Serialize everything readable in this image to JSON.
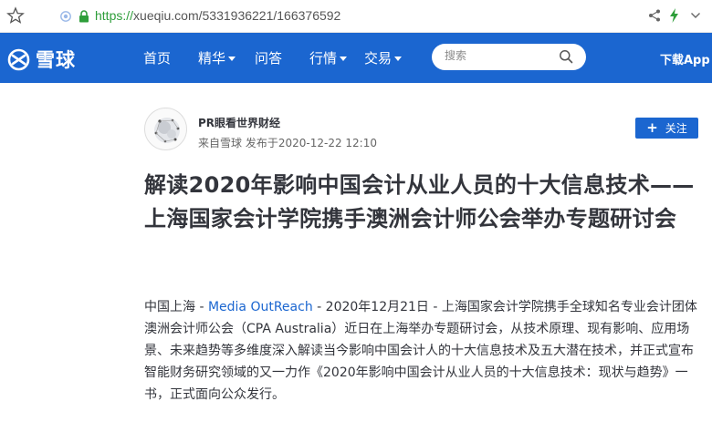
{
  "browser": {
    "url_scheme": "https://",
    "url_rest": "xueqiu.com/5331936221/166376592"
  },
  "site": {
    "logo_text": "雪球",
    "nav": [
      {
        "label": "首页",
        "has_dropdown": false
      },
      {
        "label": "精华",
        "has_dropdown": true
      },
      {
        "label": "问答",
        "has_dropdown": false
      },
      {
        "label": "行情",
        "has_dropdown": true
      },
      {
        "label": "交易",
        "has_dropdown": true
      }
    ],
    "search_placeholder": "搜索",
    "download_label": "下载App",
    "brand_color": "#1b66d0"
  },
  "author": {
    "name": "PR眼看世界财经",
    "source": "来自雪球",
    "published": "发布于2020-12-22 12:10",
    "follow_label": "关注"
  },
  "article": {
    "title": "解读2020年影响中国会计从业人员的十大信息技术——上海国家会计学院携手澳洲会计师公会举办专题研讨会",
    "lead_location": "中国上海 - ",
    "lead_source": "Media OutReach",
    "lead_rest": " - 2020年12月21日 - 上海国家会计学院携手全球知名专业会计团体澳洲会计师公会（CPA Australia）近日在上海举办专题研讨会，从技术原理、现有影响、应用场景、未来趋势等多维度深入解读当今影响中国会计人的十大信息技术及五大潜在技术，并正式宣布智能财务研究领域的又一力作《2020年影响中国会计从业人员的十大信息技术：现状与趋势》一书，正式面向公众发行。"
  }
}
